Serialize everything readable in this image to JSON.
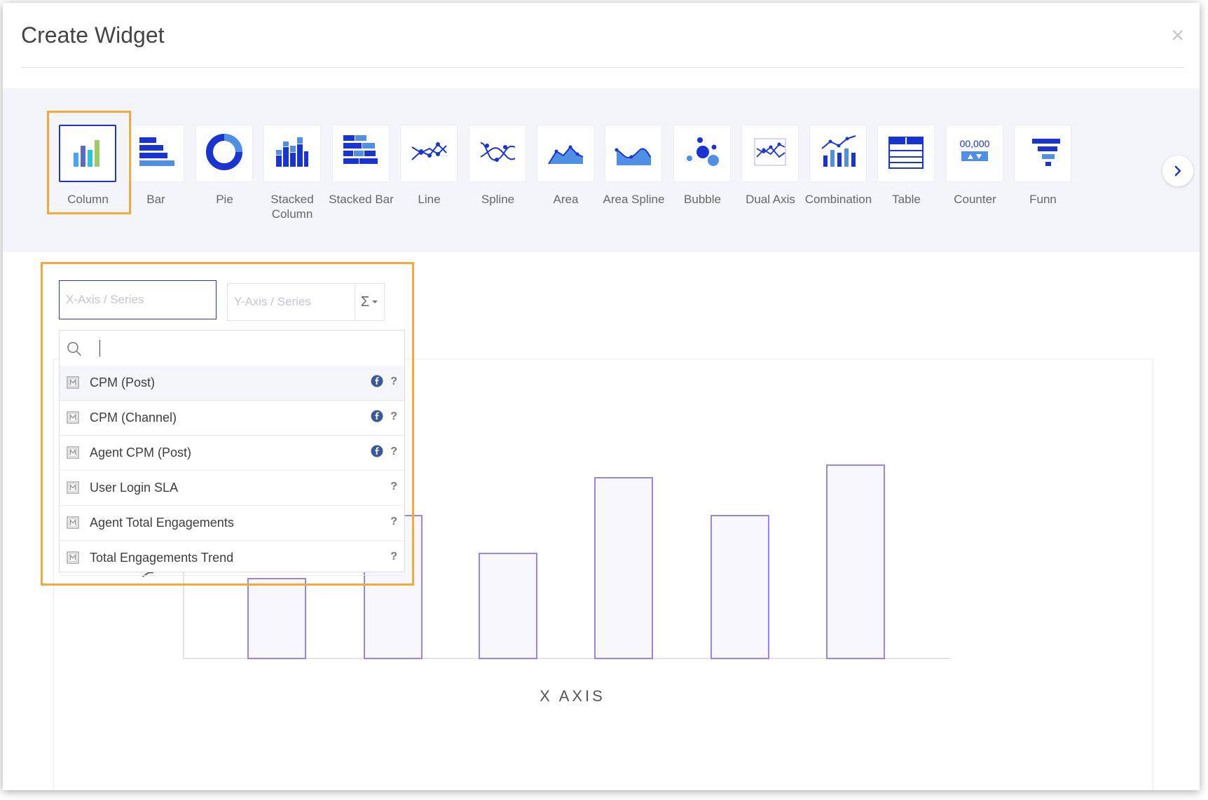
{
  "modal": {
    "title": "Create Widget",
    "close_symbol": "×"
  },
  "chart_types": [
    {
      "key": "column",
      "label": "Column",
      "icon": "column-chart-icon",
      "selected": true
    },
    {
      "key": "bar",
      "label": "Bar",
      "icon": "bar-chart-icon"
    },
    {
      "key": "pie",
      "label": "Pie",
      "icon": "pie-chart-icon"
    },
    {
      "key": "stacked-column",
      "label": "Stacked Column",
      "icon": "stacked-column-icon"
    },
    {
      "key": "stacked-bar",
      "label": "Stacked Bar",
      "icon": "stacked-bar-icon"
    },
    {
      "key": "line",
      "label": "Line",
      "icon": "line-chart-icon"
    },
    {
      "key": "spline",
      "label": "Spline",
      "icon": "spline-chart-icon"
    },
    {
      "key": "area",
      "label": "Area",
      "icon": "area-chart-icon"
    },
    {
      "key": "area-spline",
      "label": "Area Spline",
      "icon": "area-spline-icon"
    },
    {
      "key": "bubble",
      "label": "Bubble",
      "icon": "bubble-chart-icon"
    },
    {
      "key": "dual-axis",
      "label": "Dual Axis",
      "icon": "dual-axis-icon"
    },
    {
      "key": "combination",
      "label": "Combination",
      "icon": "combination-chart-icon"
    },
    {
      "key": "table",
      "label": "Table",
      "icon": "table-icon"
    },
    {
      "key": "counter",
      "label": "Counter",
      "icon": "counter-icon",
      "counter_text": "00,000"
    },
    {
      "key": "funnel",
      "label": "Funn",
      "icon": "funnel-icon"
    }
  ],
  "fields": {
    "x_axis_placeholder": "X-Axis / Series",
    "y_axis_placeholder": "Y-Axis / Series",
    "aggregate_symbol": "Σ"
  },
  "metric_dropdown": {
    "search_value": "",
    "items": [
      {
        "label": "CPM (Post)",
        "facebook": true,
        "help": "?",
        "active": true
      },
      {
        "label": "CPM (Channel)",
        "facebook": true,
        "help": "?"
      },
      {
        "label": "Agent CPM (Post)",
        "facebook": true,
        "help": "?"
      },
      {
        "label": "User Login SLA",
        "facebook": false,
        "help": "?"
      },
      {
        "label": "Agent Total Engagements",
        "facebook": false,
        "help": "?"
      },
      {
        "label": "Total Engagements Trend",
        "facebook": false,
        "help": "?"
      }
    ]
  },
  "chart_data": {
    "type": "bar",
    "categories": [
      "",
      "",
      "",
      "",
      "",
      "",
      ""
    ],
    "values": [
      38,
      68,
      50,
      86,
      68,
      92
    ],
    "xlabel": "X AXIS",
    "ylabel": "Y AXIS",
    "ylim": [
      0,
      100
    ],
    "grid": false,
    "colors": {
      "bar_fill": "#f8f7fd",
      "bar_stroke": "#9c83e8"
    }
  },
  "colors": {
    "accent": "#2033c8",
    "icon_blue": "#1a34d1",
    "icon_light": "#4f8fe6",
    "highlight_frame": "#f6a93b",
    "strip_bg": "#f4f5fa"
  }
}
